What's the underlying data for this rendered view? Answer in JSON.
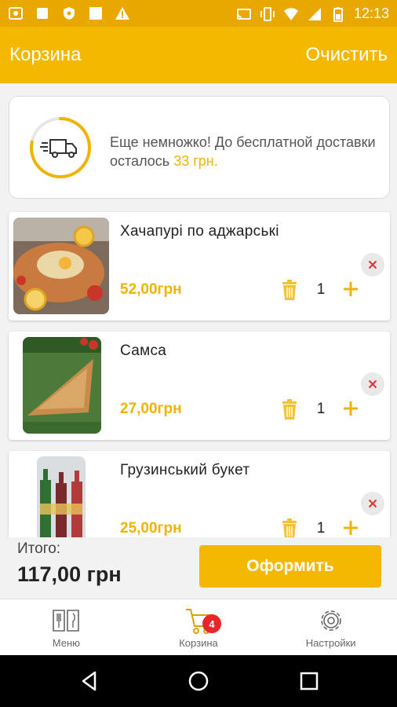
{
  "status_bar": {
    "time": "12:13",
    "left_icons": [
      "cast-icon",
      "stop-icon",
      "shield-icon",
      "square-icon",
      "warning-icon"
    ],
    "right_icons": [
      "screencast-icon",
      "vibrate-icon",
      "wifi-icon",
      "signal-icon",
      "battery-icon"
    ]
  },
  "app_bar": {
    "title": "Корзина",
    "clear_label": "Очистить"
  },
  "delivery": {
    "message": "Еще немножко! До бесплатной доставки осталось",
    "amount": "33 грн.",
    "progress": 0.78,
    "accent": "#f0b400"
  },
  "items": [
    {
      "name": "Хачапурі по аджарські",
      "price": "52,00грн",
      "quantity": "1"
    },
    {
      "name": "Самса",
      "price": "27,00грн",
      "quantity": "1"
    },
    {
      "name": "Грузинський букет",
      "price": "25,00грн",
      "quantity": "1"
    }
  ],
  "summary": {
    "total_label": "Итого:",
    "total_value": "117,00 грн",
    "checkout_label": "Оформить"
  },
  "bottom_nav": {
    "menu_label": "Меню",
    "cart_label": "Корзина",
    "cart_badge": "4",
    "settings_label": "Настройки"
  },
  "colors": {
    "primary": "#f5b800",
    "status_bar": "#e9a800",
    "price": "#f0b400",
    "badge": "#e8262a"
  }
}
